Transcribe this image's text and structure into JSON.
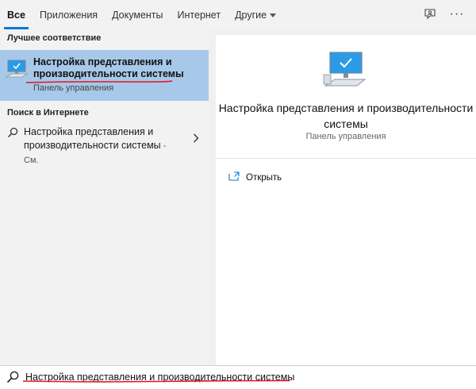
{
  "tabs": [
    {
      "label": "Все",
      "active": true
    },
    {
      "label": "Приложения"
    },
    {
      "label": "Документы"
    },
    {
      "label": "Интернет"
    },
    {
      "label": "Другие"
    }
  ],
  "left": {
    "best_match_header": "Лучшее соответствие",
    "best_match": {
      "title": "Настройка представления и производительности системы",
      "subtitle": "Панель управления"
    },
    "web_header": "Поиск в Интернете",
    "web_item": {
      "text": "Настройка представления и производительности системы",
      "suffix": " - См."
    }
  },
  "right": {
    "title": "Настройка представления и производительности системы",
    "subtitle": "Панель управления",
    "action_open": "Открыть"
  },
  "search": {
    "value": "Настройка представления и производительности системы"
  },
  "icons": {
    "feedback": "feedback-icon",
    "more": "more-options-icon",
    "search": "search-icon",
    "chevron": "chevron-right-icon",
    "open": "open-window-icon",
    "computer": "computer-icon"
  },
  "colors": {
    "accent": "#0078d7",
    "selection": "#a7c8e8",
    "annotation": "#e81123"
  }
}
